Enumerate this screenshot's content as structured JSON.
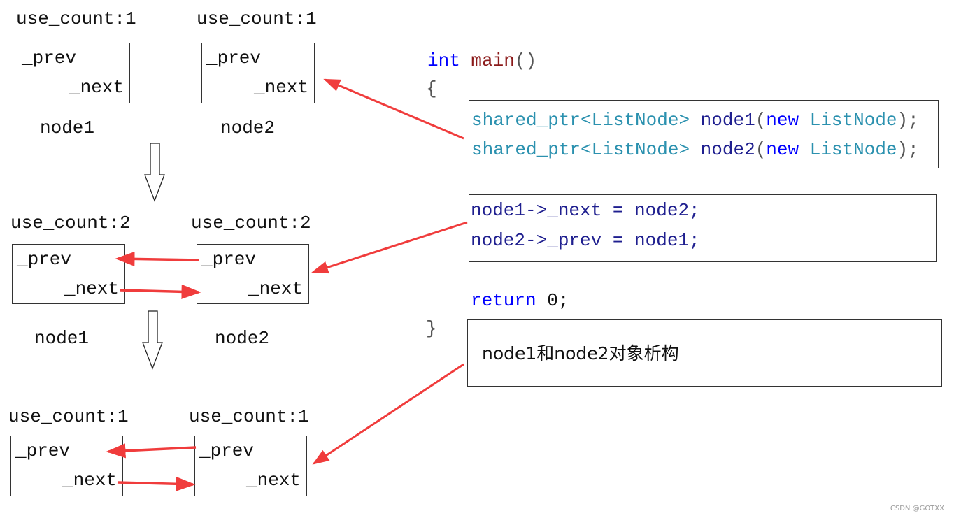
{
  "stages": [
    {
      "counts": [
        "use_count:1",
        "use_count:1"
      ],
      "nodes": [
        "node1",
        "node2"
      ]
    },
    {
      "counts": [
        "use_count:2",
        "use_count:2"
      ],
      "nodes": [
        "node1",
        "node2"
      ]
    },
    {
      "counts": [
        "use_count:1",
        "use_count:1"
      ]
    }
  ],
  "field_prev": "_prev",
  "field_next": "_next",
  "code": {
    "int": "int",
    "main": "main",
    "parens": "()",
    "open": "{",
    "close": "}",
    "type": "shared_ptr<ListNode>",
    "node1": "node1",
    "node2": "node2",
    "new": "new",
    "listnode": "ListNode",
    "p_open": "(",
    "p_close": ");",
    "assign1": "node1->_next = node2;",
    "assign2": "node2->_prev = node1;",
    "return_kw": "return",
    "return_val": " 0;",
    "destruct": "node1和node2对象析构"
  },
  "colors": {
    "arrow": "#f03c3c",
    "keyword": "#0000ff",
    "type": "#2b91af",
    "variable": "#1f1f8f"
  },
  "watermark": "CSDN @GOTXX"
}
